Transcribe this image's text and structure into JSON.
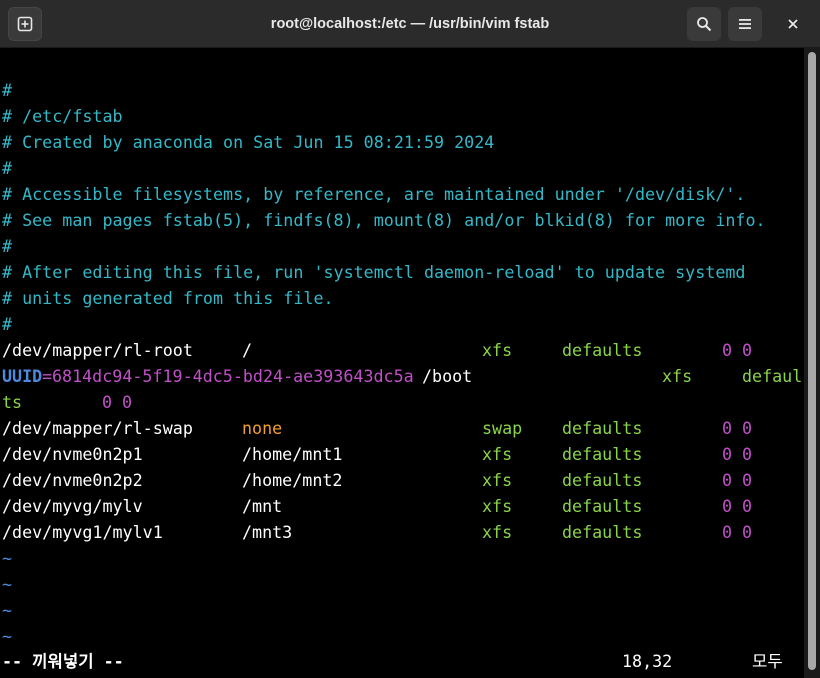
{
  "window": {
    "title": "root@localhost:/etc — /usr/bin/vim fstab",
    "icons": [
      "new-tab-icon",
      "search-icon",
      "menu-icon",
      "close-icon"
    ]
  },
  "colors": {
    "comment": "#34b8c8",
    "text": "#ffffff",
    "orange": "#f0a030",
    "green": "#8ad44a",
    "magenta": "#c050c8",
    "tilde": "#4d8adf",
    "background": "#000000"
  },
  "editor": {
    "comments": [
      "#",
      "# /etc/fstab",
      "# Created by anaconda on Sat Jun 15 08:21:59 2024",
      "#",
      "# Accessible filesystems, by reference, are maintained under '/dev/disk/'.",
      "# See man pages fstab(5), findfs(8), mount(8) and/or blkid(8) for more info.",
      "#",
      "# After editing this file, run 'systemctl daemon-reload' to update systemd",
      "# units generated from this file.",
      "#"
    ],
    "entries": [
      {
        "device": "/dev/mapper/rl-root",
        "mount": "/",
        "type": "xfs",
        "options": "defaults",
        "dump": "0",
        "pass": "0"
      },
      {
        "device": "/dev/mapper/rl-swap",
        "mount": "none",
        "type": "swap",
        "options": "defaults",
        "dump": "0",
        "pass": "0"
      },
      {
        "device": "/dev/nvme0n2p1",
        "mount": "/home/mnt1",
        "type": "xfs",
        "options": "defaults",
        "dump": "0",
        "pass": "0"
      },
      {
        "device": "/dev/nvme0n2p2",
        "mount": "/home/mnt2",
        "type": "xfs",
        "options": "defaults",
        "dump": "0",
        "pass": "0"
      },
      {
        "device": "/dev/myvg/mylv",
        "mount": "/mnt",
        "type": "xfs",
        "options": "defaults",
        "dump": "0",
        "pass": "0"
      },
      {
        "device": "/dev/myvg1/mylv1",
        "mount": "/mnt3",
        "type": "xfs",
        "options": "defaults",
        "dump": "0",
        "pass": "0"
      }
    ],
    "uuid_line": {
      "key": "UUID",
      "eq": "=",
      "value": "6814dc94-5f19-4dc5-bd24-ae393643dc5a",
      "mount": "/boot",
      "type": "xfs",
      "options_part1": "defaul",
      "options_part2": "ts",
      "dump": "0",
      "pass": "0"
    },
    "tildes": [
      "~",
      "~",
      "~",
      "~"
    ]
  },
  "status": {
    "mode": "-- 끼워넣기 --",
    "position": "18,32",
    "scroll": "모두"
  }
}
